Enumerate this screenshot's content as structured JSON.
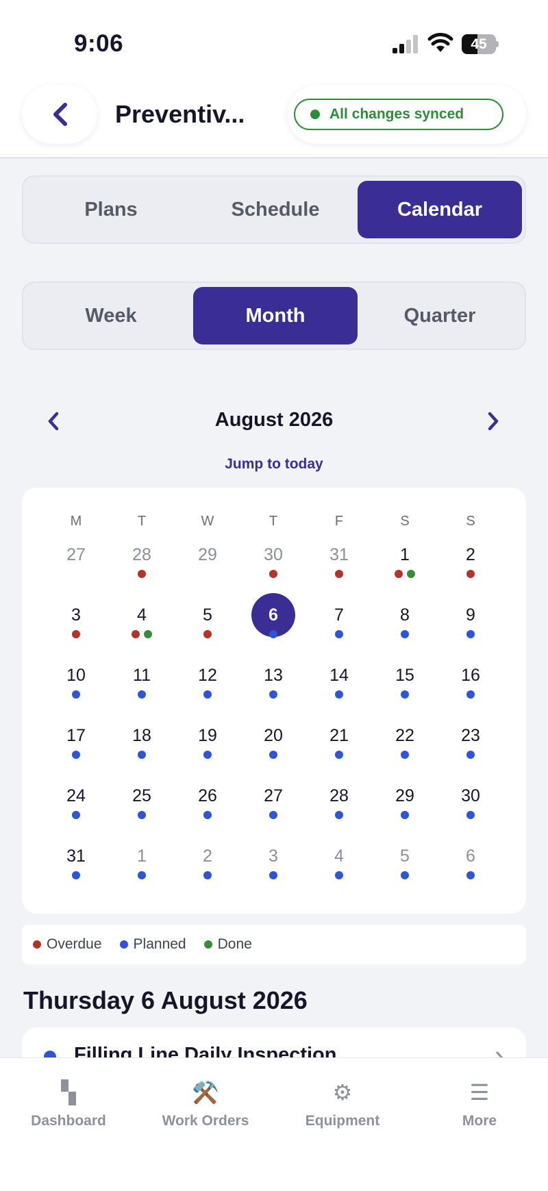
{
  "status_bar": {
    "time": "9:06",
    "battery": "45",
    "battery_level": 0.45
  },
  "header": {
    "title": "Preventiv...",
    "sync_status": "All changes synced"
  },
  "view_tabs": [
    {
      "label": "Plans",
      "active": false
    },
    {
      "label": "Schedule",
      "active": false
    },
    {
      "label": "Calendar",
      "active": true
    }
  ],
  "range_tabs": [
    {
      "label": "Week",
      "active": false
    },
    {
      "label": "Month",
      "active": true
    },
    {
      "label": "Quarter",
      "active": false
    }
  ],
  "calendar": {
    "month_title": "August 2026",
    "jump_label": "Jump to today",
    "weekdays": [
      "M",
      "T",
      "W",
      "T",
      "F",
      "S",
      "S"
    ],
    "weeks": [
      [
        {
          "n": "27",
          "other": true,
          "dots": []
        },
        {
          "n": "28",
          "other": true,
          "dots": [
            "overdue"
          ]
        },
        {
          "n": "29",
          "other": true,
          "dots": []
        },
        {
          "n": "30",
          "other": true,
          "dots": [
            "overdue"
          ]
        },
        {
          "n": "31",
          "other": true,
          "dots": [
            "overdue"
          ]
        },
        {
          "n": "1",
          "dots": [
            "overdue",
            "done"
          ]
        },
        {
          "n": "2",
          "dots": [
            "overdue"
          ]
        }
      ],
      [
        {
          "n": "3",
          "dots": [
            "overdue"
          ]
        },
        {
          "n": "4",
          "dots": [
            "overdue",
            "done"
          ]
        },
        {
          "n": "5",
          "dots": [
            "overdue"
          ]
        },
        {
          "n": "6",
          "today": true,
          "dots": [
            "planned"
          ]
        },
        {
          "n": "7",
          "dots": [
            "planned"
          ]
        },
        {
          "n": "8",
          "dots": [
            "planned"
          ]
        },
        {
          "n": "9",
          "dots": [
            "planned"
          ]
        }
      ],
      [
        {
          "n": "10",
          "dots": [
            "planned"
          ]
        },
        {
          "n": "11",
          "dots": [
            "planned"
          ]
        },
        {
          "n": "12",
          "dots": [
            "planned"
          ]
        },
        {
          "n": "13",
          "dots": [
            "planned"
          ]
        },
        {
          "n": "14",
          "dots": [
            "planned"
          ]
        },
        {
          "n": "15",
          "dots": [
            "planned"
          ]
        },
        {
          "n": "16",
          "dots": [
            "planned"
          ]
        }
      ],
      [
        {
          "n": "17",
          "dots": [
            "planned"
          ]
        },
        {
          "n": "18",
          "dots": [
            "planned"
          ]
        },
        {
          "n": "19",
          "dots": [
            "planned"
          ]
        },
        {
          "n": "20",
          "dots": [
            "planned"
          ]
        },
        {
          "n": "21",
          "dots": [
            "planned"
          ]
        },
        {
          "n": "22",
          "dots": [
            "planned"
          ]
        },
        {
          "n": "23",
          "dots": [
            "planned"
          ]
        }
      ],
      [
        {
          "n": "24",
          "dots": [
            "planned"
          ]
        },
        {
          "n": "25",
          "dots": [
            "planned"
          ]
        },
        {
          "n": "26",
          "dots": [
            "planned"
          ]
        },
        {
          "n": "27",
          "dots": [
            "planned"
          ]
        },
        {
          "n": "28",
          "dots": [
            "planned"
          ]
        },
        {
          "n": "29",
          "dots": [
            "planned"
          ]
        },
        {
          "n": "30",
          "dots": [
            "planned"
          ]
        }
      ],
      [
        {
          "n": "31",
          "dots": [
            "planned"
          ]
        },
        {
          "n": "1",
          "other": true,
          "dots": [
            "planned"
          ]
        },
        {
          "n": "2",
          "other": true,
          "dots": [
            "planned"
          ]
        },
        {
          "n": "3",
          "other": true,
          "dots": [
            "planned"
          ]
        },
        {
          "n": "4",
          "other": true,
          "dots": [
            "planned"
          ]
        },
        {
          "n": "5",
          "other": true,
          "dots": [
            "planned"
          ]
        },
        {
          "n": "6",
          "other": true,
          "dots": [
            "planned"
          ]
        }
      ]
    ]
  },
  "legend": [
    {
      "key": "overdue",
      "label": "Overdue"
    },
    {
      "key": "planned",
      "label": "Planned"
    },
    {
      "key": "done",
      "label": "Done"
    }
  ],
  "colors": {
    "overdue": "#b3322a",
    "planned": "#2f55d4",
    "done": "#3a8b3e",
    "accent": "#3a2d93",
    "synced": "#2f8a3b"
  },
  "selected_date_heading": "Thursday 6 August 2026",
  "task": {
    "title": "Filling Line Daily Inspection"
  },
  "tabbar": [
    {
      "label": "Dashboard",
      "icon": "dashboard-icon",
      "glyph": ""
    },
    {
      "label": "Work Orders",
      "icon": "hammer-wrench-icon",
      "glyph": "⚒️"
    },
    {
      "label": "Equipment",
      "icon": "gear-icon",
      "glyph": "⚙"
    },
    {
      "label": "More",
      "icon": "menu-icon",
      "glyph": "☰"
    }
  ]
}
